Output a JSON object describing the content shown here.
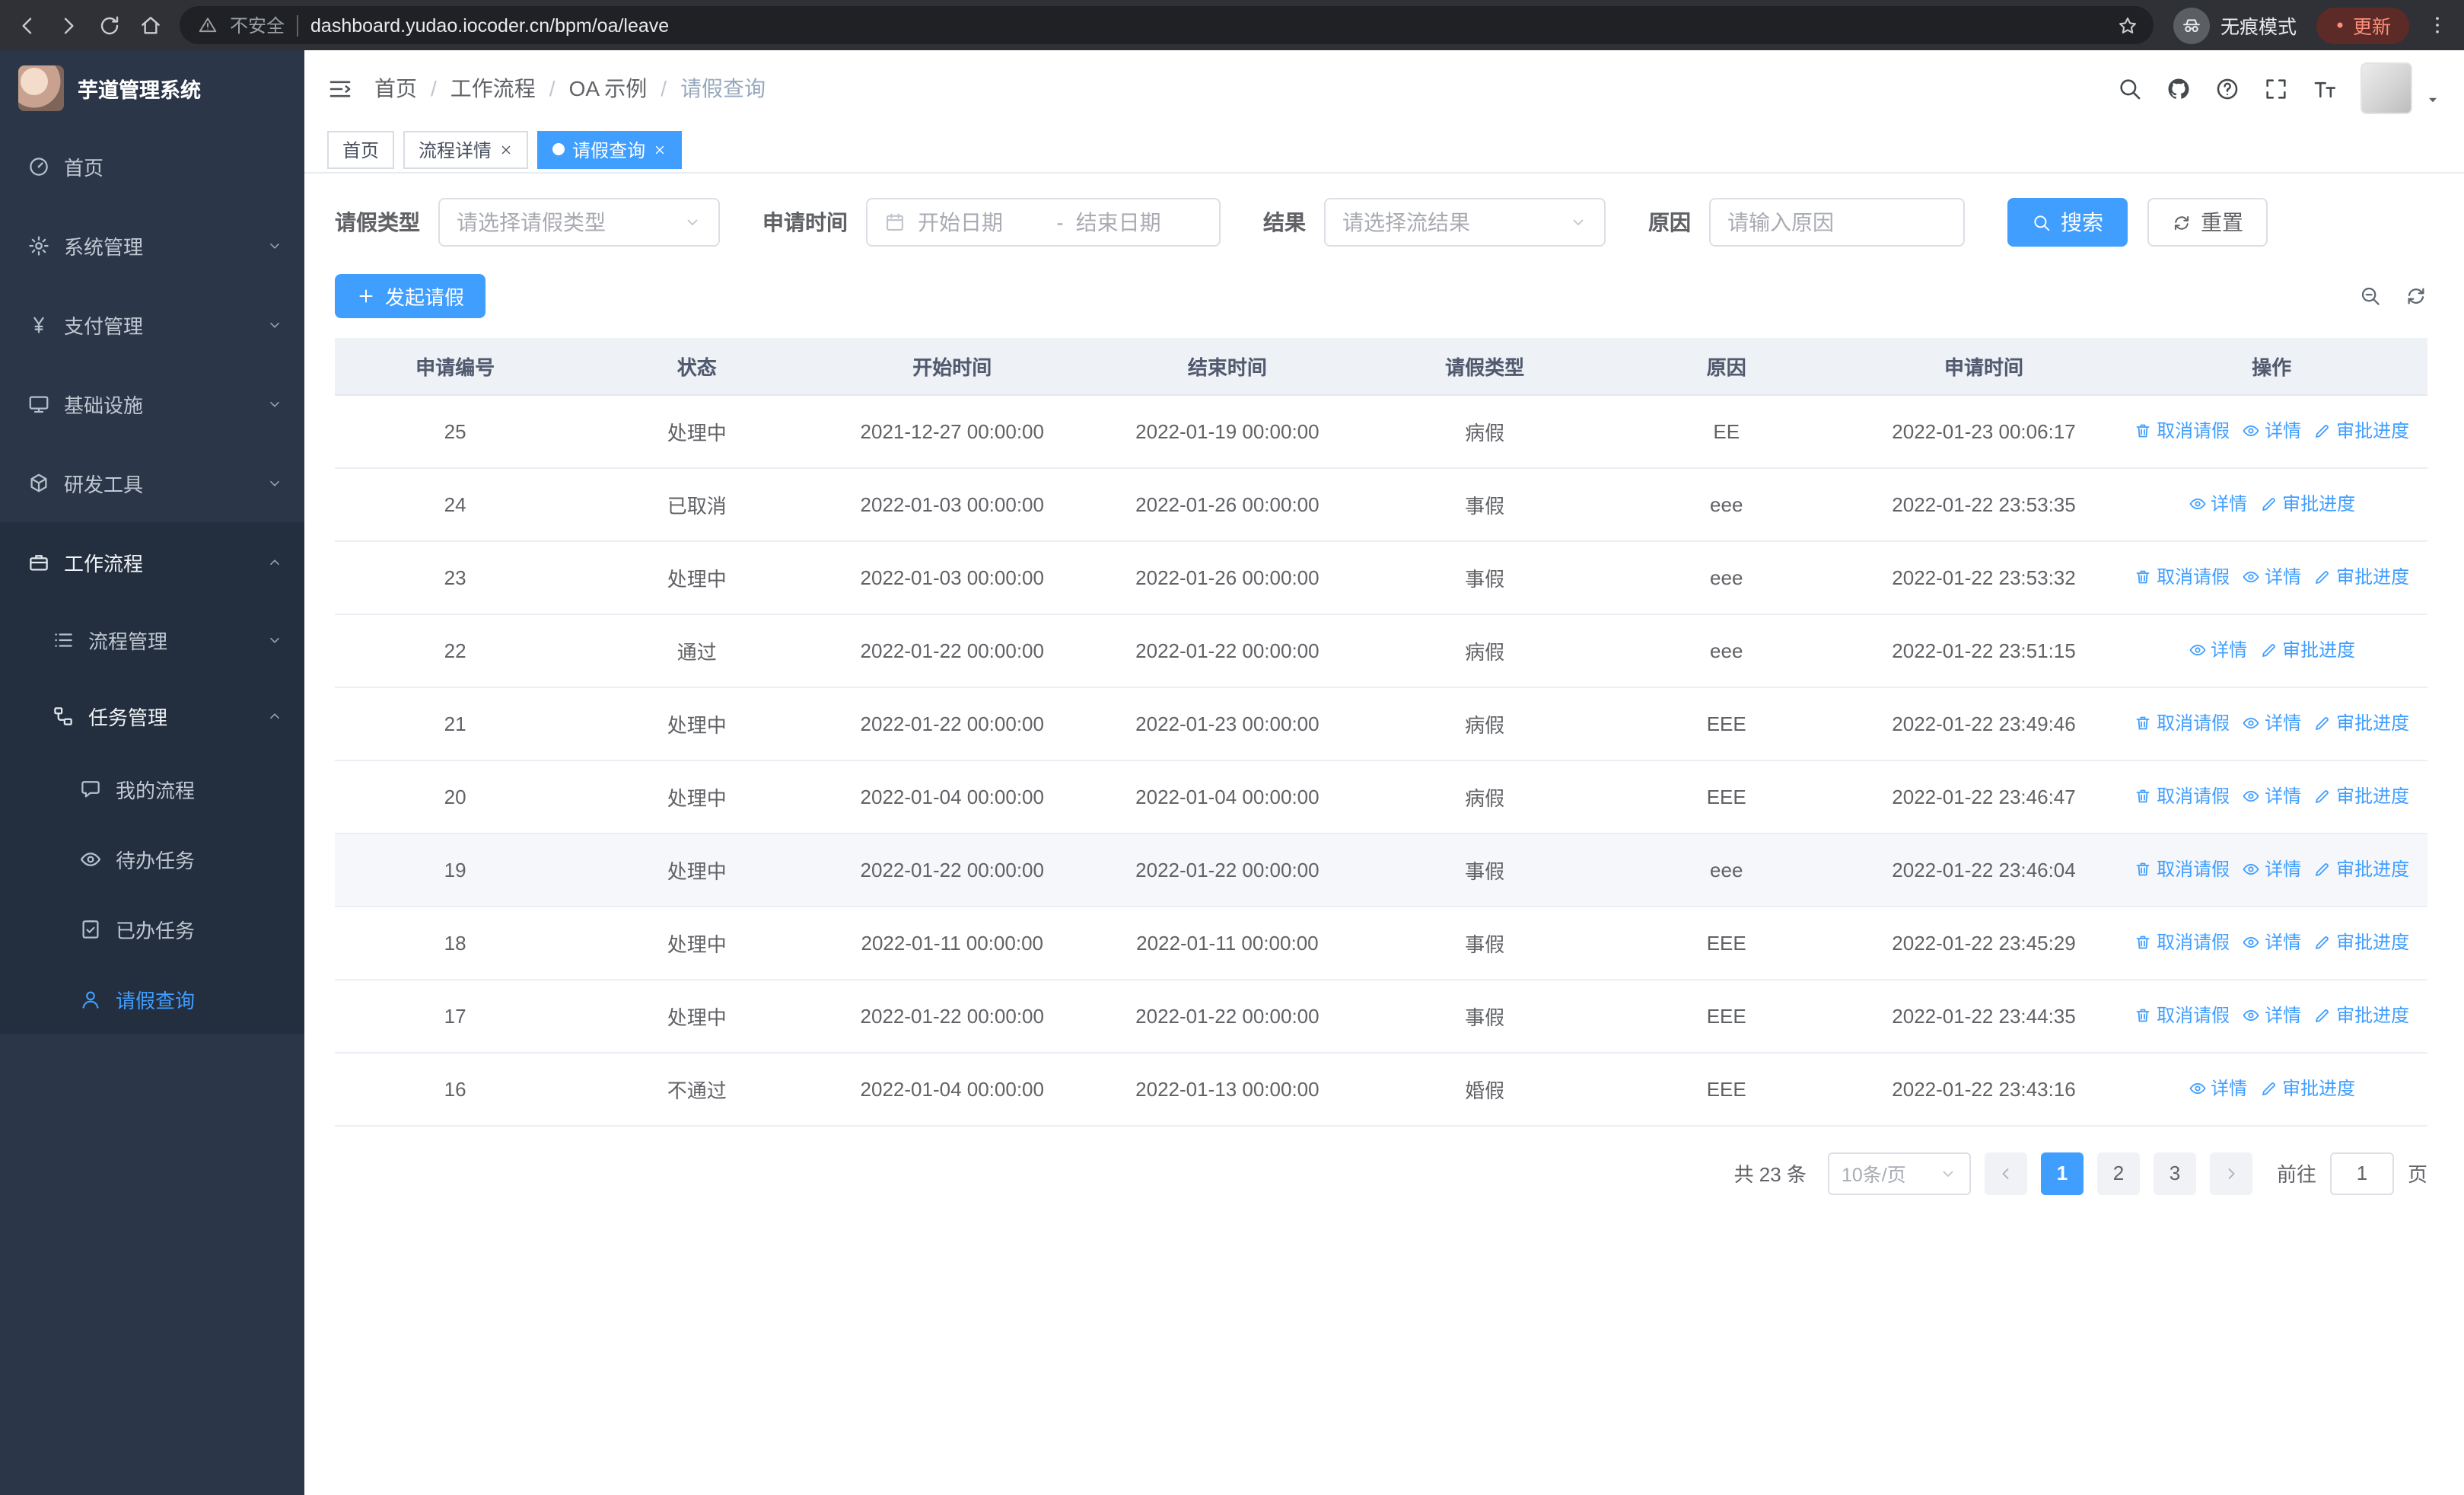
{
  "colors": {
    "accent": "#409eff",
    "sidebar_bg": "#2b3648",
    "header_bg": "#eef1f6"
  },
  "browser": {
    "security_chip": "不安全",
    "url": "dashboard.yudao.iocoder.cn/bpm/oa/leave",
    "incognito_label": "无痕模式",
    "update_label": "更新"
  },
  "sidebar": {
    "logo_title": "芋道管理系统",
    "menu": [
      {
        "id": "home",
        "label": "首页",
        "icon": "dashboard",
        "level": 1
      },
      {
        "id": "system",
        "label": "系统管理",
        "icon": "gear",
        "level": 1,
        "chevron": "down"
      },
      {
        "id": "payment",
        "label": "支付管理",
        "icon": "yen",
        "level": 1,
        "chevron": "down"
      },
      {
        "id": "infra",
        "label": "基础设施",
        "icon": "monitor",
        "level": 1,
        "chevron": "down"
      },
      {
        "id": "devtools",
        "label": "研发工具",
        "icon": "cube",
        "level": 1,
        "chevron": "down"
      },
      {
        "id": "workflow",
        "label": "工作流程",
        "icon": "briefcase",
        "level": 1,
        "chevron": "up",
        "section": true,
        "open": true
      },
      {
        "id": "process-mgmt",
        "label": "流程管理",
        "icon": "list",
        "level": 2,
        "chevron": "down",
        "section": true
      },
      {
        "id": "task-mgmt",
        "label": "任务管理",
        "icon": "flow",
        "level": 2,
        "chevron": "up",
        "section": true,
        "open": true
      },
      {
        "id": "my-process",
        "label": "我的流程",
        "icon": "chat",
        "level": 3,
        "section": true
      },
      {
        "id": "todo-task",
        "label": "待办任务",
        "icon": "eye",
        "level": 3,
        "section": true
      },
      {
        "id": "done-task",
        "label": "已办任务",
        "icon": "clipboard-check",
        "level": 3,
        "section": true
      },
      {
        "id": "leave-query",
        "label": "请假查询",
        "icon": "user",
        "level": 3,
        "section": true,
        "active": true
      }
    ]
  },
  "header": {
    "separator": "/",
    "breadcrumb": [
      {
        "label": "首页"
      },
      {
        "label": "工作流程"
      },
      {
        "label": "OA 示例"
      },
      {
        "label": "请假查询",
        "current": true
      }
    ]
  },
  "tabs": [
    {
      "id": "home",
      "label": "首页"
    },
    {
      "id": "process-detail",
      "label": "流程详情",
      "closable": true
    },
    {
      "id": "leave-query",
      "label": "请假查询",
      "closable": true,
      "active": true
    }
  ],
  "filters": {
    "leave_type_label": "请假类型",
    "leave_type_placeholder": "请选择请假类型",
    "apply_time_label": "申请时间",
    "start_date_placeholder": "开始日期",
    "range_separator": "-",
    "end_date_placeholder": "结束日期",
    "result_label": "结果",
    "result_placeholder": "请选择流结果",
    "reason_label": "原因",
    "reason_placeholder": "请输入原因",
    "search_label": "搜索",
    "reset_label": "重置"
  },
  "toolbar": {
    "create_label": "发起请假"
  },
  "table": {
    "columns": [
      "申请编号",
      "状态",
      "开始时间",
      "结束时间",
      "请假类型",
      "原因",
      "申请时间",
      "操作"
    ],
    "action_labels": {
      "cancel": "取消请假",
      "detail": "详情",
      "progress": "审批进度"
    },
    "rows": [
      {
        "id": "25",
        "status": "处理中",
        "start": "2021-12-27 00:00:00",
        "end": "2022-01-19 00:00:00",
        "type": "病假",
        "reason": "EE",
        "applied": "2022-01-23 00:06:17",
        "actions": [
          "cancel",
          "detail",
          "progress"
        ]
      },
      {
        "id": "24",
        "status": "已取消",
        "start": "2022-01-03 00:00:00",
        "end": "2022-01-26 00:00:00",
        "type": "事假",
        "reason": "eee",
        "applied": "2022-01-22 23:53:35",
        "actions": [
          "detail",
          "progress"
        ]
      },
      {
        "id": "23",
        "status": "处理中",
        "start": "2022-01-03 00:00:00",
        "end": "2022-01-26 00:00:00",
        "type": "事假",
        "reason": "eee",
        "applied": "2022-01-22 23:53:32",
        "actions": [
          "cancel",
          "detail",
          "progress"
        ]
      },
      {
        "id": "22",
        "status": "通过",
        "start": "2022-01-22 00:00:00",
        "end": "2022-01-22 00:00:00",
        "type": "病假",
        "reason": "eee",
        "applied": "2022-01-22 23:51:15",
        "actions": [
          "detail",
          "progress"
        ]
      },
      {
        "id": "21",
        "status": "处理中",
        "start": "2022-01-22 00:00:00",
        "end": "2022-01-23 00:00:00",
        "type": "病假",
        "reason": "EEE",
        "applied": "2022-01-22 23:49:46",
        "actions": [
          "cancel",
          "detail",
          "progress"
        ]
      },
      {
        "id": "20",
        "status": "处理中",
        "start": "2022-01-04 00:00:00",
        "end": "2022-01-04 00:00:00",
        "type": "病假",
        "reason": "EEE",
        "applied": "2022-01-22 23:46:47",
        "actions": [
          "cancel",
          "detail",
          "progress"
        ]
      },
      {
        "id": "19",
        "status": "处理中",
        "start": "2022-01-22 00:00:00",
        "end": "2022-01-22 00:00:00",
        "type": "事假",
        "reason": "eee",
        "applied": "2022-01-22 23:46:04",
        "actions": [
          "cancel",
          "detail",
          "progress"
        ],
        "highlight": true
      },
      {
        "id": "18",
        "status": "处理中",
        "start": "2022-01-11 00:00:00",
        "end": "2022-01-11 00:00:00",
        "type": "事假",
        "reason": "EEE",
        "applied": "2022-01-22 23:45:29",
        "actions": [
          "cancel",
          "detail",
          "progress"
        ]
      },
      {
        "id": "17",
        "status": "处理中",
        "start": "2022-01-22 00:00:00",
        "end": "2022-01-22 00:00:00",
        "type": "事假",
        "reason": "EEE",
        "applied": "2022-01-22 23:44:35",
        "actions": [
          "cancel",
          "detail",
          "progress"
        ]
      },
      {
        "id": "16",
        "status": "不通过",
        "start": "2022-01-04 00:00:00",
        "end": "2022-01-13 00:00:00",
        "type": "婚假",
        "reason": "EEE",
        "applied": "2022-01-22 23:43:16",
        "actions": [
          "detail",
          "progress"
        ]
      }
    ]
  },
  "pagination": {
    "total": "共 23 条",
    "page_size": "10条/页",
    "pages": [
      "1",
      "2",
      "3"
    ],
    "active_page": "1",
    "goto_label": "前往",
    "goto_value": "1",
    "goto_unit": "页"
  }
}
